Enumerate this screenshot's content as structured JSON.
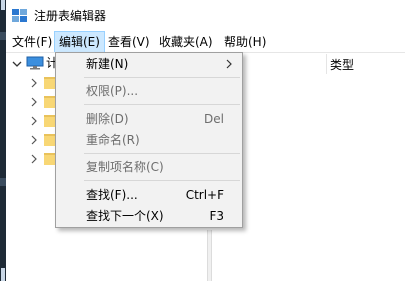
{
  "window": {
    "title": "注册表编辑器"
  },
  "menubar": [
    {
      "label": "文件(F)"
    },
    {
      "label": "编辑(E)",
      "active": true
    },
    {
      "label": "查看(V)"
    },
    {
      "label": "收藏夹(A)"
    },
    {
      "label": "帮助(H)"
    }
  ],
  "tree": {
    "root_label": "计"
  },
  "list_header": {
    "type_label": "类型"
  },
  "edit_menu": [
    {
      "label": "新建(N)",
      "shortcut": "",
      "disabled": false,
      "submenu": true
    },
    {
      "label": "权限(P)...",
      "shortcut": "",
      "disabled": true
    },
    {
      "label": "删除(D)",
      "shortcut": "Del",
      "disabled": true
    },
    {
      "label": "重命名(R)",
      "shortcut": "",
      "disabled": true
    },
    {
      "label": "复制项名称(C)",
      "shortcut": "",
      "disabled": true
    },
    {
      "label": "查找(F)...",
      "shortcut": "Ctrl+F",
      "disabled": false
    },
    {
      "label": "查找下一个(X)",
      "shortcut": "F3",
      "disabled": false
    }
  ],
  "icons": {
    "app": "registry-editor-icon",
    "computer": "computer-icon",
    "folder": "folder-icon",
    "expand": "chevron-right-icon",
    "collapse": "chevron-down-icon",
    "submenu": "submenu-arrow-icon"
  },
  "colors": {
    "menu_active_bg": "#cce8ff",
    "menu_bg": "#f2f2f2",
    "folder": "#f8d775",
    "disabled_text": "#6d6d6d"
  }
}
